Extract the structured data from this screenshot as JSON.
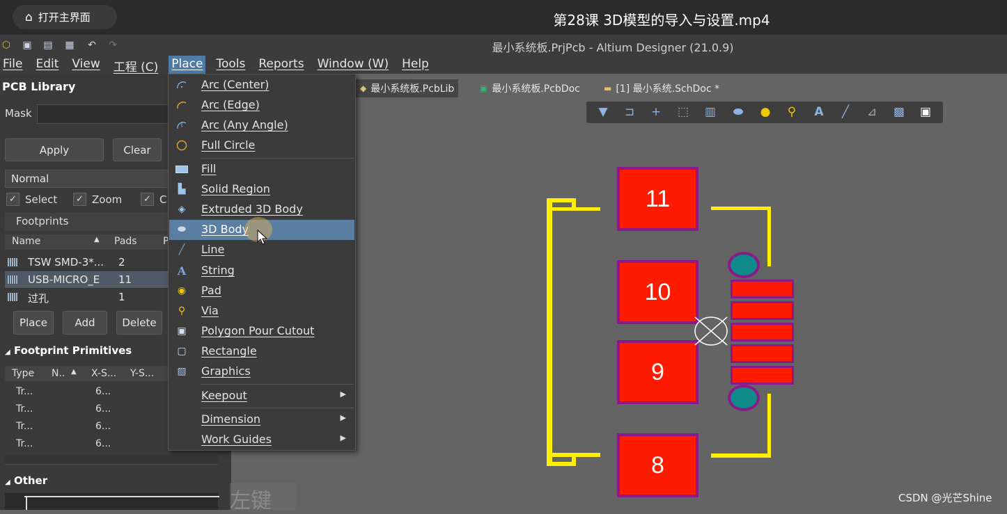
{
  "video": {
    "home_label": "打开主界面",
    "title": "第28课 3D模型的导入与设置.mp4"
  },
  "app": {
    "title": "最小系统板.PrjPcb - Altium Designer (21.0.9)"
  },
  "menubar": [
    "File",
    "Edit",
    "View",
    "工程 (C)",
    "Place",
    "Tools",
    "Reports",
    "Window (W)",
    "Help"
  ],
  "panel": {
    "title": "PCB Library",
    "mask_label": "Mask",
    "apply": "Apply",
    "clear": "Clear",
    "normal": "Normal",
    "checks": [
      "Select",
      "Zoom",
      "C"
    ],
    "footprints": "Footprints",
    "fp_columns": [
      "Name",
      "Pads",
      "P"
    ],
    "footprint_rows": [
      {
        "name": "TSW SMD-3*...",
        "pads": "2"
      },
      {
        "name": "USB-MICRO_E",
        "pads": "11"
      },
      {
        "name": "过孔",
        "pads": "1"
      }
    ],
    "buttons": [
      "Place",
      "Add",
      "Delete"
    ],
    "primitives_title": "Footprint Primitives",
    "prim_columns": [
      "Type",
      "N..",
      "X-S...",
      "Y-S..."
    ],
    "prim_rows": [
      {
        "type": "Tr...",
        "x": "6..."
      },
      {
        "type": "Tr...",
        "x": "6..."
      },
      {
        "type": "Tr...",
        "x": "6..."
      },
      {
        "type": "Tr...",
        "x": "6..."
      }
    ],
    "other_title": "Other"
  },
  "place_menu": {
    "items": [
      {
        "label": "Arc (Center)",
        "icon": "arc-center-icon"
      },
      {
        "label": "Arc (Edge)",
        "icon": "arc-edge-icon"
      },
      {
        "label": "Arc (Any Angle)",
        "icon": "arc-any-icon"
      },
      {
        "label": "Full Circle",
        "icon": "circle-icon"
      },
      {
        "label": "Fill",
        "icon": "fill-icon"
      },
      {
        "label": "Solid Region",
        "icon": "region-icon"
      },
      {
        "label": "Extruded 3D Body",
        "icon": "extruded-body-icon"
      },
      {
        "label": "3D Body",
        "icon": "3d-body-icon"
      },
      {
        "label": "Line",
        "icon": "line-icon"
      },
      {
        "label": "String",
        "icon": "string-icon"
      },
      {
        "label": "Pad",
        "icon": "pad-icon"
      },
      {
        "label": "Via",
        "icon": "via-icon"
      },
      {
        "label": "Polygon Pour Cutout",
        "icon": "polygon-cutout-icon"
      },
      {
        "label": "Rectangle",
        "icon": "rectangle-icon"
      },
      {
        "label": "Graphics",
        "icon": "graphics-icon"
      },
      {
        "label": "Keepout",
        "icon": ""
      },
      {
        "label": "Dimension",
        "icon": ""
      },
      {
        "label": "Work Guides",
        "icon": ""
      }
    ],
    "highlighted": "3D Body"
  },
  "tabs": [
    "最小系统板.PcbLib",
    "最小系统板.PcbDoc",
    "[1] 最小系统.SchDoc *"
  ],
  "pads": [
    "11",
    "10",
    "9",
    "8"
  ],
  "overlay_text": "左键",
  "watermark": "CSDN @光芒Shine"
}
